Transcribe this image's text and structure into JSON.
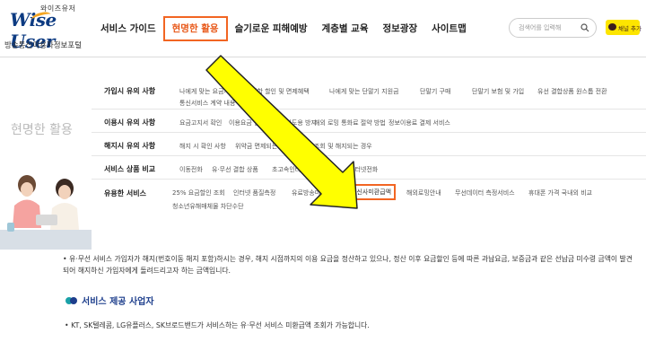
{
  "header": {
    "logo_top": "와이즈유저",
    "logo_mark": "Wise User",
    "logo_sub": "방송통신이용자정보포털",
    "nav": [
      "서비스 가이드",
      "현명한 활용",
      "슬기로운 피해예방",
      "계층별 교육",
      "정보광장",
      "사이트맵"
    ],
    "active_nav_index": 1,
    "search_placeholder": "검색어를 입력해",
    "kakao_label": "채널 추가",
    "accent_color": "#f26522"
  },
  "mega_menu": {
    "section_title": "현명한 활용",
    "rows": [
      {
        "title": "가입시 유의 사항",
        "items": [
          "나에게 맞는 요금제",
          "결합 할인 및 면제혜택",
          "나에게 맞는 단말기 지원금",
          "단말기 구매",
          "단말기 보험 및 가입",
          "유선 결합상품 원스톱 전환",
          "통신서비스 계약 내용 확인"
        ]
      },
      {
        "title": "이용시 유의 사항",
        "items": [
          "요금고지서 확인",
          "이용요금 절약",
          "명의도용 방지",
          "해외 로밍 통화료 절약 방법",
          "정보이용료 결제 서비스"
        ]
      },
      {
        "title": "해지시 유의 사항",
        "items": [
          "해지 시 확인 사항",
          "위약금 면제되는 경우",
          "미환급금 조회 및 해지되는 경우"
        ]
      },
      {
        "title": "서비스 상품 비교",
        "items": [
          "이동전화",
          "유·무선 결합 상품",
          "초고속인터넷·IPTV",
          "인터넷전화"
        ]
      },
      {
        "title": "유용한 서비스",
        "items": [
          "25% 요금할인 조회",
          "인터넷 품질측정",
          "유료방송미환급액",
          "통신사미환급액",
          "해외로밍안내",
          "무선데이터 측정서비스",
          "휴대폰 가격 국내외 비교",
          "청소년유해매체물 차단수단"
        ],
        "highlighted_index": 3
      }
    ]
  },
  "content": {
    "paragraph": "• 유·무선 서비스 가입자가 해지(번호이동 해지 포함)하시는 경우, 해지 시점까지의 이용 요금을 정산하고 있으나, 정산 이후 요금할인 등에 따른 과납요금, 보증금과 같은 선납금 미수령 금액이 발견되어 해지하신 가입자에게 돌려드리고자 하는 금액입니다.",
    "section_title": "서비스 제공 사업자",
    "provider_text": "• KT, SK텔레콤, LG유플러스, SK브로드밴드가 서비스하는 유·무선 서비스 미환급액 조회가 가능합니다."
  }
}
